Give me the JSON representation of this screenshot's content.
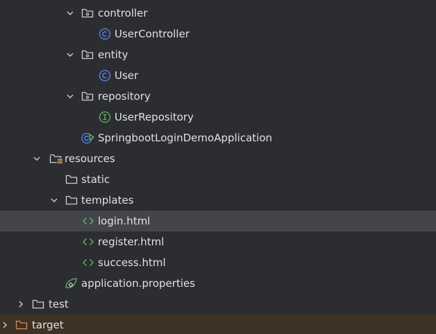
{
  "project_tree": {
    "items": [
      {
        "label": "controller",
        "icon": "package-folder-icon",
        "expanded": true
      },
      {
        "label": "UserController",
        "icon": "class-icon"
      },
      {
        "label": "entity",
        "icon": "package-folder-icon",
        "expanded": true
      },
      {
        "label": "User",
        "icon": "class-icon"
      },
      {
        "label": "repository",
        "icon": "package-folder-icon",
        "expanded": true
      },
      {
        "label": "UserRepository",
        "icon": "interface-icon"
      },
      {
        "label": "SpringbootLoginDemoApplication",
        "icon": "spring-boot-application-icon"
      },
      {
        "label": "resources",
        "icon": "resources-folder-icon",
        "expanded": true
      },
      {
        "label": "static",
        "icon": "folder-icon"
      },
      {
        "label": "templates",
        "icon": "folder-icon",
        "expanded": true
      },
      {
        "label": "login.html",
        "icon": "html-file-icon",
        "selected": true
      },
      {
        "label": "register.html",
        "icon": "html-file-icon"
      },
      {
        "label": "success.html",
        "icon": "html-file-icon"
      },
      {
        "label": "application.properties",
        "icon": "spring-properties-icon"
      },
      {
        "label": "test",
        "icon": "folder-icon",
        "expanded": false
      },
      {
        "label": "target",
        "icon": "excluded-folder-icon",
        "expanded": false
      }
    ]
  },
  "colors": {
    "background": "#2b2d30",
    "selected_row": "#43454a",
    "excluded_row": "#3d3223",
    "text": "#dfe1e5",
    "class_blue": "#548af7",
    "interface_green": "#5fb865",
    "html_green": "#5fb865",
    "excluded_orange": "#e08855"
  }
}
